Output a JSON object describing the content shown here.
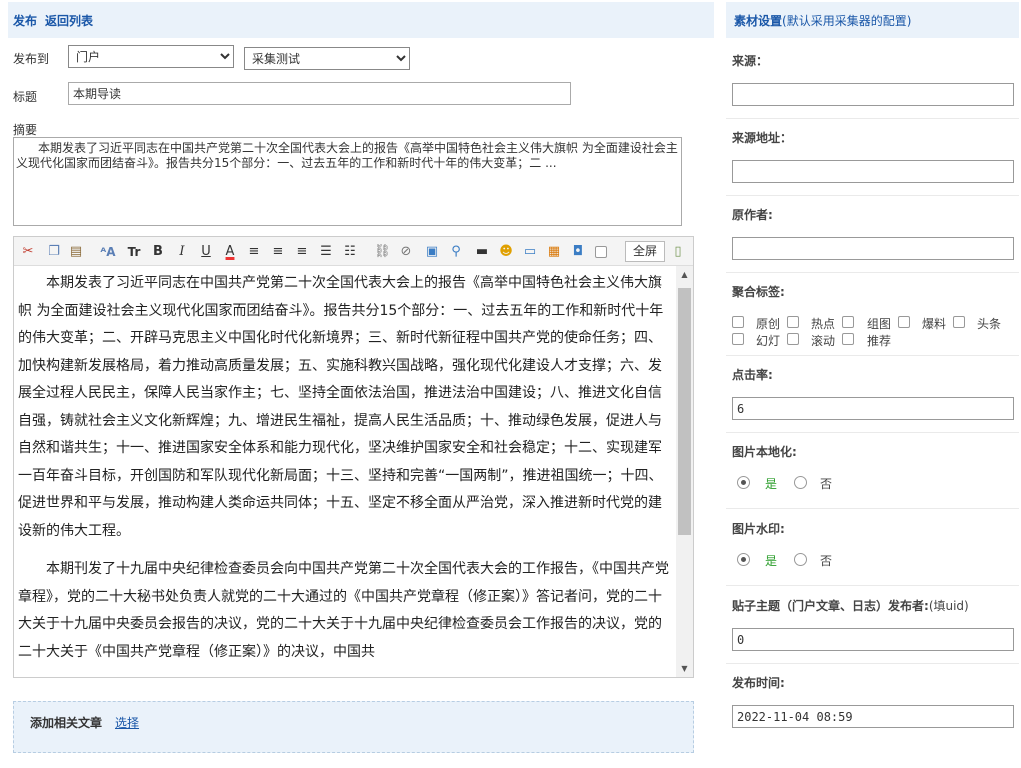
{
  "header": {
    "publish": "发布",
    "back_to_list": "返回列表"
  },
  "form": {
    "publish_to_label": "发布到",
    "portal_select": "门户",
    "category_select": "采集测试",
    "title_label": "标题",
    "title_value": "本期导读",
    "summary_label": "摘要",
    "summary_text": "本期发表了习近平同志在中国共产党第二十次全国代表大会上的报告《高举中国特色社会主义伟大旗帜 为全面建设社会主义现代化国家而团结奋斗》。报告共分15个部分：一、过去五年的工作和新时代十年的伟大变革；二 ..."
  },
  "editor": {
    "fullscreen_label": "全屏",
    "paragraphs": [
      "本期发表了习近平同志在中国共产党第二十次全国代表大会上的报告《高举中国特色社会主义伟大旗帜 为全面建设社会主义现代化国家而团结奋斗》。报告共分15个部分：一、过去五年的工作和新时代十年的伟大变革；二、开辟马克思主义中国化时代化新境界；三、新时代新征程中国共产党的使命任务；四、加快构建新发展格局，着力推动高质量发展；五、实施科教兴国战略，强化现代化建设人才支撑；六、发展全过程人民民主，保障人民当家作主；七、坚持全面依法治国，推进法治中国建设；八、推进文化自信自强，铸就社会主义文化新辉煌；九、增进民生福祉，提高人民生活品质；十、推动绿色发展，促进人与自然和谐共生；十一、推进国家安全体系和能力现代化，坚决维护国家安全和社会稳定；十二、实现建军一百年奋斗目标，开创国防和军队现代化新局面；十三、坚持和完善“一国两制”，推进祖国统一；十四、促进世界和平与发展，推动构建人类命运共同体；十五、坚定不移全面从严治党，深入推进新时代党的建设新的伟大工程。",
      "本期刊发了十九届中央纪律检查委员会向中国共产党第二十次全国代表大会的工作报告，《中国共产党章程》，党的二十大秘书处负责人就党的二十大通过的《中国共产党章程（修正案）》答记者问，党的二十大关于十九届中央委员会报告的决议，党的二十大关于十九届中央纪律检查委员会工作报告的决议，党的二十大关于《中国共产党章程（修正案）》的决议，中国共"
    ],
    "toolbar_icons": [
      "cut-icon",
      "copy-icon",
      "paste-icon",
      "font-family-icon",
      "font-size-icon",
      "bold-icon",
      "italic-icon",
      "underline-icon",
      "font-color-icon",
      "align-left-icon",
      "align-center-icon",
      "align-right-icon",
      "ordered-list-icon",
      "unordered-list-icon",
      "link-icon",
      "unlink-icon",
      "image-icon",
      "attachment-icon",
      "video-icon",
      "emoji-icon",
      "page-break-icon",
      "insert-media-icon",
      "save-icon",
      "checkbox-icon",
      "source-icon"
    ]
  },
  "related": {
    "label": "添加相关文章",
    "select_link": "选择"
  },
  "sidebar": {
    "title": "素材设置",
    "title_note": "(默认采用采集器的配置)",
    "source_label": "来源：",
    "source_value": "",
    "source_url_label": "来源地址：",
    "source_url_value": "",
    "author_label": "原作者:",
    "author_value": "",
    "tags_label": "聚合标签:",
    "tags": [
      "原创",
      "热点",
      "组图",
      "爆料",
      "头条",
      "幻灯",
      "滚动",
      "推荐"
    ],
    "clicks_label": "点击率:",
    "clicks_value": "6",
    "img_local_label": "图片本地化:",
    "img_watermark_label": "图片水印:",
    "yes": "是",
    "no": "否",
    "poster_label": "贴子主题（门户文章、日志）发布者:",
    "poster_note": "(填uid)",
    "poster_value": "0",
    "publish_time_label": "发布时间:",
    "publish_time_value": "2022-11-04 08:59"
  },
  "colors": {
    "accent": "#1a57a8",
    "green": "#2a9d2a",
    "panel_bg": "#eaf2fa"
  }
}
